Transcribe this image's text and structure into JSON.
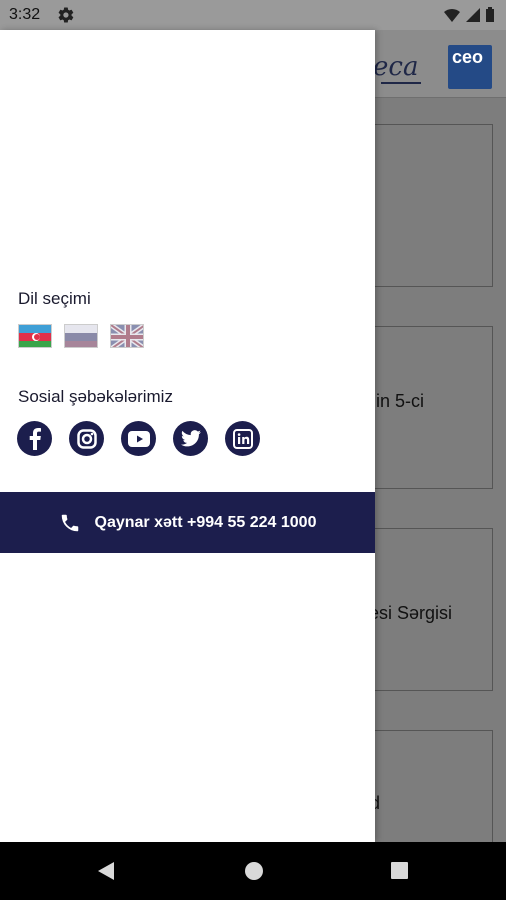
{
  "status_bar": {
    "time": "3:32",
    "icons": [
      "gear-icon",
      "wifi-icon",
      "signal-icon",
      "battery-icon"
    ]
  },
  "background_app": {
    "logo_text": "eca",
    "ceo_logo_text": "ceo",
    "cards": [
      {
        "text": ""
      },
      {
        "text": "in 5-ci"
      },
      {
        "text": "esi Sərgisi"
      },
      {
        "text": "d"
      }
    ]
  },
  "drawer": {
    "language_title": "Dil seçimi",
    "languages": [
      {
        "code": "az",
        "icon": "flag-azerbaijan-icon"
      },
      {
        "code": "ru",
        "icon": "flag-russia-icon"
      },
      {
        "code": "en",
        "icon": "flag-uk-icon"
      }
    ],
    "social_title": "Sosial şəbəkələrimiz",
    "social": [
      {
        "name": "facebook",
        "icon": "facebook-icon"
      },
      {
        "name": "instagram",
        "icon": "instagram-icon"
      },
      {
        "name": "youtube",
        "icon": "youtube-icon"
      },
      {
        "name": "twitter",
        "icon": "twitter-icon"
      },
      {
        "name": "linkedin",
        "icon": "linkedin-icon"
      }
    ],
    "hotline_label": "Qaynar xətt +994 55 224 1000"
  },
  "colors": {
    "brand": "#1c1e4d",
    "scrim": "#7d7d7d"
  },
  "nav_bar": {
    "icons": [
      "back-icon",
      "home-icon",
      "recents-icon"
    ]
  }
}
